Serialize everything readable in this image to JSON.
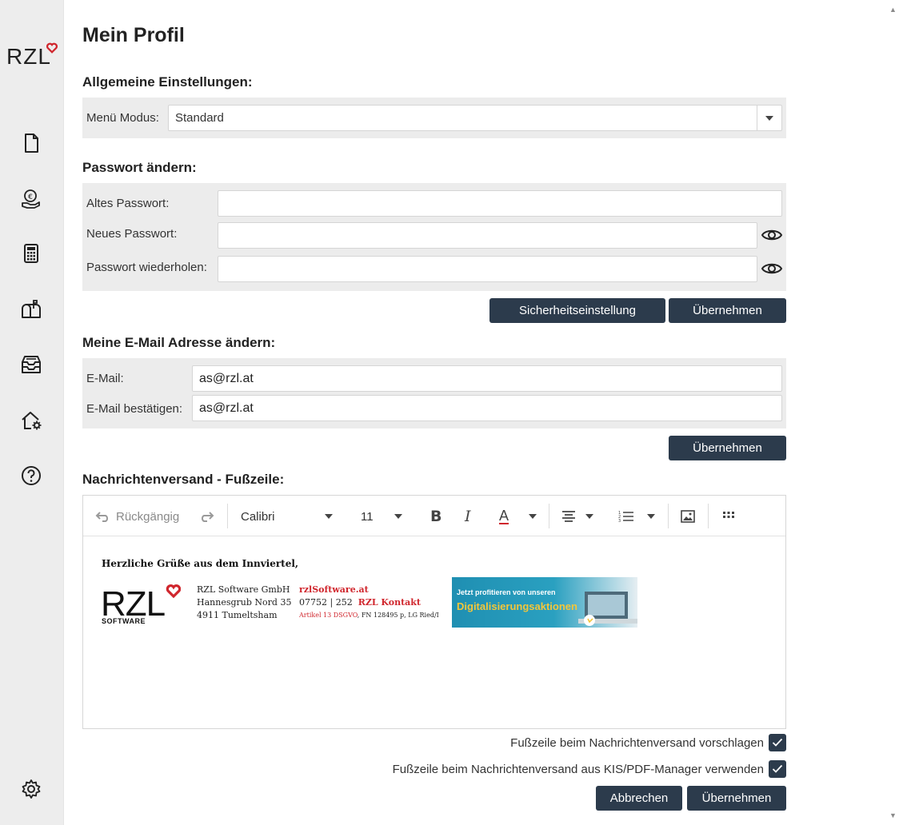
{
  "brand": {
    "logo_text": "RZL",
    "accent": "#d0262d",
    "button_color": "#2c3b4c"
  },
  "sidebar": {
    "items": [
      {
        "icon": "document-icon"
      },
      {
        "icon": "euro-hand-icon"
      },
      {
        "icon": "calculator-icon"
      },
      {
        "icon": "mailbox-icon"
      },
      {
        "icon": "inbox-tray-icon"
      },
      {
        "icon": "home-settings-icon"
      },
      {
        "icon": "help-icon"
      }
    ],
    "settings_icon": "gear-icon"
  },
  "page": {
    "title": "Mein Profil"
  },
  "general": {
    "title": "Allgemeine Einstellungen:",
    "menu_mode_label": "Menü Modus:",
    "menu_mode_value": "Standard"
  },
  "password": {
    "title": "Passwort ändern:",
    "old_label": "Altes Passwort:",
    "new_label": "Neues Passwort:",
    "repeat_label": "Passwort wiederholen:",
    "old_value": "",
    "new_value": "",
    "repeat_value": "",
    "security_button": "Sicherheitseinstellung",
    "apply_button": "Übernehmen"
  },
  "email": {
    "title": "Meine E-Mail Adresse ändern:",
    "email_label": "E-Mail:",
    "confirm_label": "E-Mail bestätigen:",
    "email_value": "as@rzl.at",
    "confirm_value": "as@rzl.at",
    "apply_button": "Übernehmen"
  },
  "footer": {
    "title": "Nachrichtenversand - Fußzeile:",
    "toolbar": {
      "undo": "Rückgängig",
      "font": "Calibri",
      "size": "11"
    },
    "signature": {
      "greeting": "Herzliche Grüße aus dem Innviertel,",
      "logo_sub": "SOFTWARE",
      "company": "RZL Software GmbH",
      "street": "Hannesgrub Nord 35",
      "city": "4911 Tumeltsham",
      "website": "rzlSoftware.at",
      "phone": "07752 | 252",
      "contact": "RZL Kontakt",
      "legal_red": "Artikel 13 DSGVO",
      "legal_rest": ", FN 128495 p, LG Ried/I",
      "banner_line1": "Jetzt profitieren von unseren",
      "banner_line2": "Digitalisierungsaktionen"
    },
    "suggest_label": "Fußzeile beim Nachrichtenversand vorschlagen",
    "suggest_checked": true,
    "kis_label": "Fußzeile beim Nachrichtenversand aus KIS/PDF-Manager verwenden",
    "kis_checked": true,
    "cancel_button": "Abbrechen",
    "apply_button": "Übernehmen"
  }
}
